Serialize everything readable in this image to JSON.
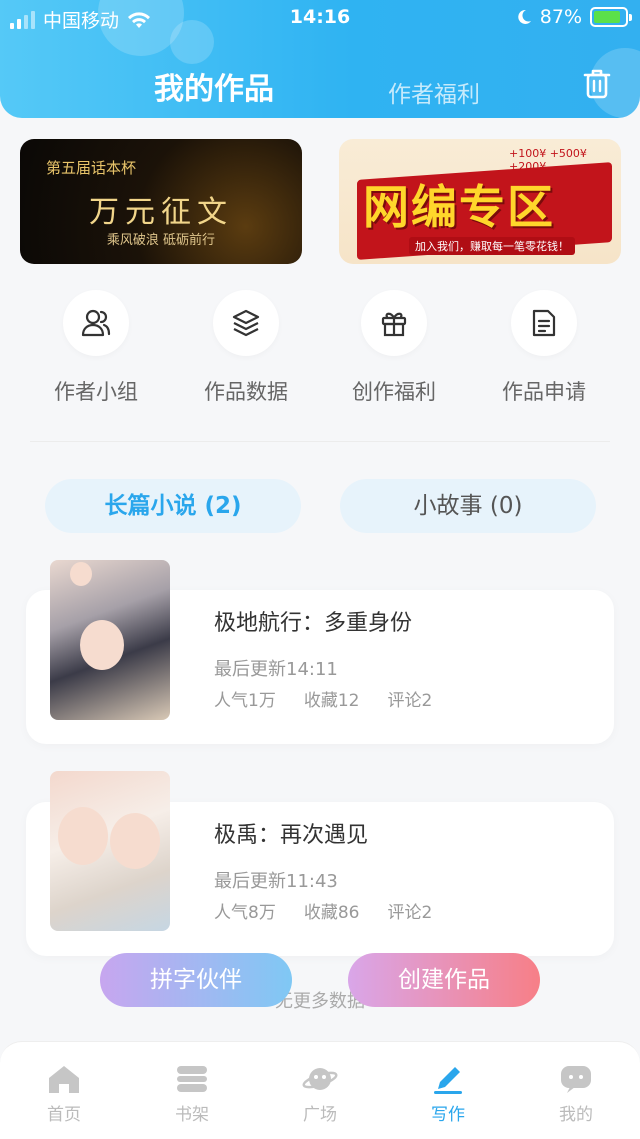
{
  "status_bar": {
    "carrier": "中国移动",
    "time": "14:16",
    "battery": "87%"
  },
  "header": {
    "tab_works": "我的作品",
    "tab_welfare": "作者福利"
  },
  "banners": {
    "left": {
      "small": "第五届话本杯",
      "big": "万元征文",
      "sub": "乘风破浪  砥砺前行"
    },
    "right": {
      "big": "网编专区",
      "tag": "加入我们，赚取每一笔零花钱！",
      "bonus": "+100¥  +500¥  +200¥"
    }
  },
  "features": [
    {
      "label": "作者小组",
      "icon": "group-icon"
    },
    {
      "label": "作品数据",
      "icon": "layers-icon"
    },
    {
      "label": "创作福利",
      "icon": "gift-icon"
    },
    {
      "label": "作品申请",
      "icon": "document-icon"
    }
  ],
  "segments": {
    "novel": "长篇小说 (2)",
    "story": "小故事 (0)"
  },
  "works": [
    {
      "title": "极地航行：多重身份",
      "updated": "最后更新14:11",
      "popularity": "人气1万",
      "favorites": "收藏12",
      "comments": "评论2"
    },
    {
      "title": "极禹：再次遇见",
      "updated": "最后更新11:43",
      "popularity": "人气8万",
      "favorites": "收藏86",
      "comments": "评论2"
    }
  ],
  "no_more": "无更多数据",
  "fab": {
    "partner": "拼字伙伴",
    "create": "创建作品"
  },
  "tabbar": [
    {
      "label": "首页",
      "icon": "home-icon"
    },
    {
      "label": "书架",
      "icon": "bookshelf-icon"
    },
    {
      "label": "广场",
      "icon": "planet-icon"
    },
    {
      "label": "写作",
      "icon": "pen-icon"
    },
    {
      "label": "我的",
      "icon": "chat-icon"
    }
  ],
  "colors": {
    "accent": "#2aa6ec",
    "header": "#33b0f0"
  }
}
